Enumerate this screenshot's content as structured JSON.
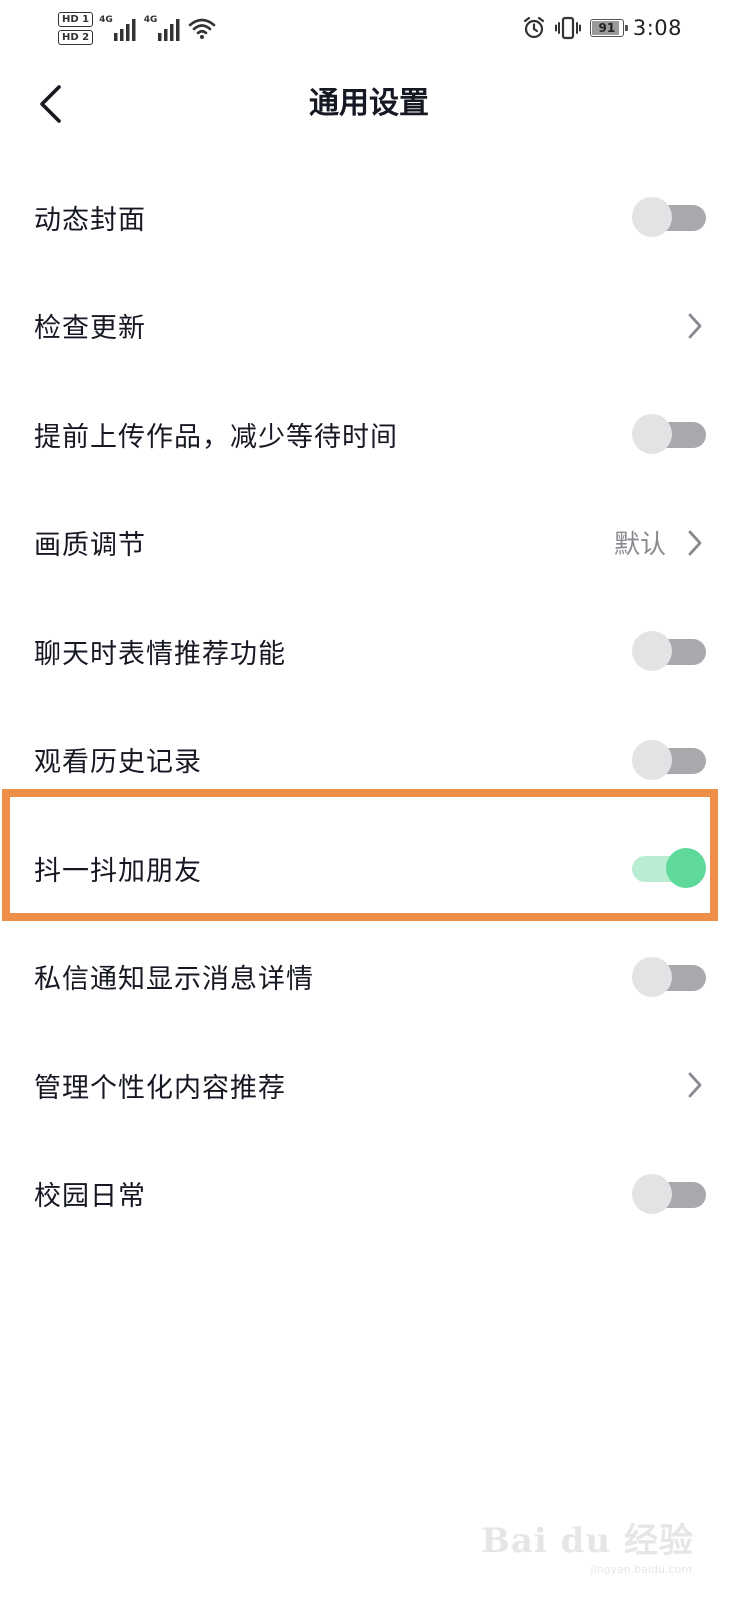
{
  "status_bar": {
    "sim1_badge": "HD 1",
    "sim2_badge": "HD 2",
    "network1": "4G",
    "network2": "4G",
    "battery_level": "91",
    "battery_fraction": 0.91,
    "time": "3:08"
  },
  "header": {
    "title": "通用设置",
    "back_icon": "chevron-left-icon"
  },
  "settings": {
    "items": [
      {
        "label": "动态封面",
        "control": "toggle",
        "on": false
      },
      {
        "label": "检查更新",
        "control": "chevron"
      },
      {
        "label": "提前上传作品，减少等待时间",
        "control": "toggle",
        "on": false
      },
      {
        "label": "画质调节",
        "control": "chevron",
        "value": "默认"
      },
      {
        "label": "聊天时表情推荐功能",
        "control": "toggle",
        "on": false
      },
      {
        "label": "观看历史记录",
        "control": "toggle",
        "on": false
      },
      {
        "label": "抖一抖加朋友",
        "control": "toggle",
        "on": true,
        "highlighted": true
      },
      {
        "label": "私信通知显示消息详情",
        "control": "toggle",
        "on": false
      },
      {
        "label": "管理个性化内容推荐",
        "control": "chevron"
      },
      {
        "label": "校园日常",
        "control": "toggle",
        "on": false
      }
    ]
  },
  "colors": {
    "toggle_on_knob": "#5ed99a",
    "toggle_on_track": "#b9edd3",
    "toggle_off_knob": "#e3e3e6",
    "toggle_off_track": "#a9a9ad",
    "highlight_border": "#ed8f47",
    "text_primary": "#161823",
    "text_secondary": "#8a8b91"
  },
  "watermark": {
    "brand": "Bai du 经验",
    "sub": "jingyan.baidu.com"
  }
}
